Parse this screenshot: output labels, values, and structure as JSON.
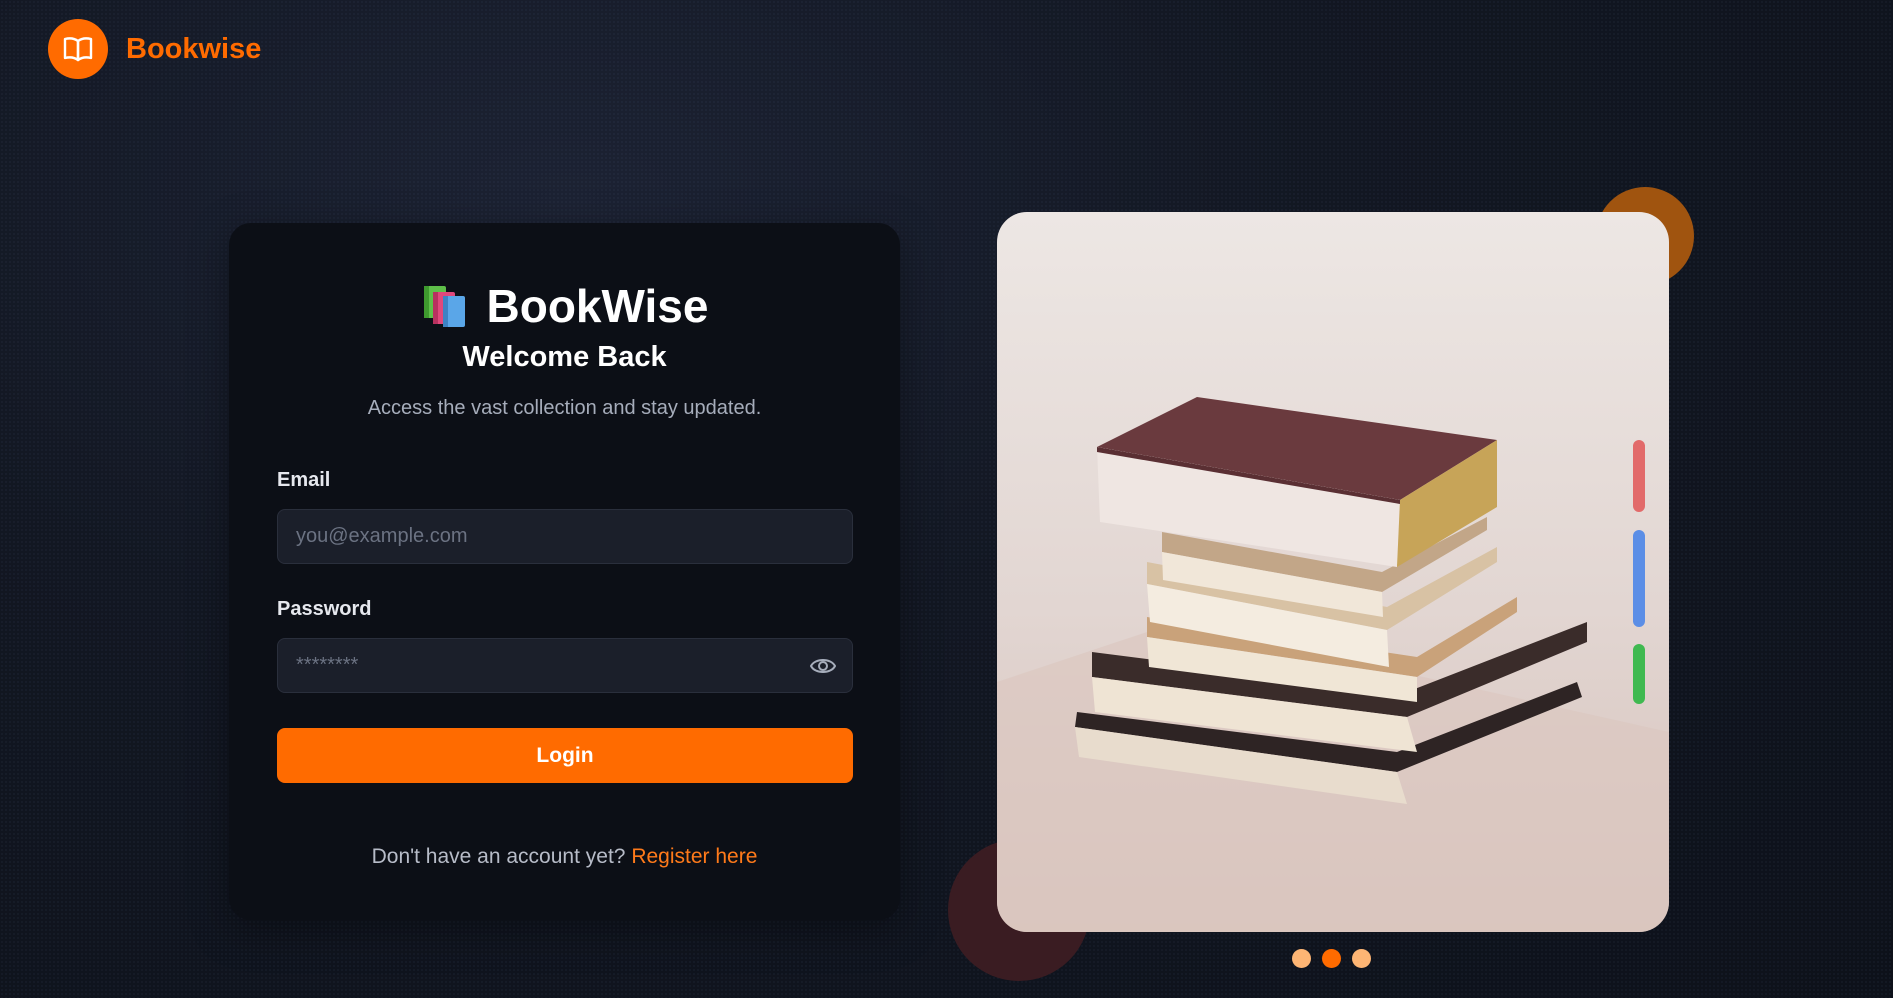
{
  "header": {
    "brand_name": "Bookwise",
    "brand_icon": "open-book-icon"
  },
  "card": {
    "logo_emoji": "books-icon",
    "logo_title": "BookWise",
    "welcome": "Welcome Back",
    "subtitle": "Access the vast collection and stay updated.",
    "email_label": "Email",
    "email_placeholder": "you@example.com",
    "email_value": "",
    "password_label": "Password",
    "password_placeholder": "********",
    "password_value": "",
    "login_label": "Login",
    "register_prompt": "Don't have an account yet?",
    "register_link": "Register here"
  },
  "carousel": {
    "image_description": "stack of books",
    "indicator_colors": [
      "#e26a6a",
      "#5b8ee6",
      "#3fb950"
    ],
    "dot_colors": [
      "#fdb574",
      "#ff6b00",
      "#fdb574"
    ],
    "active_dot": 1
  },
  "colors": {
    "accent": "#ff6b00",
    "background": "#121722",
    "card": "#0c0f16"
  }
}
